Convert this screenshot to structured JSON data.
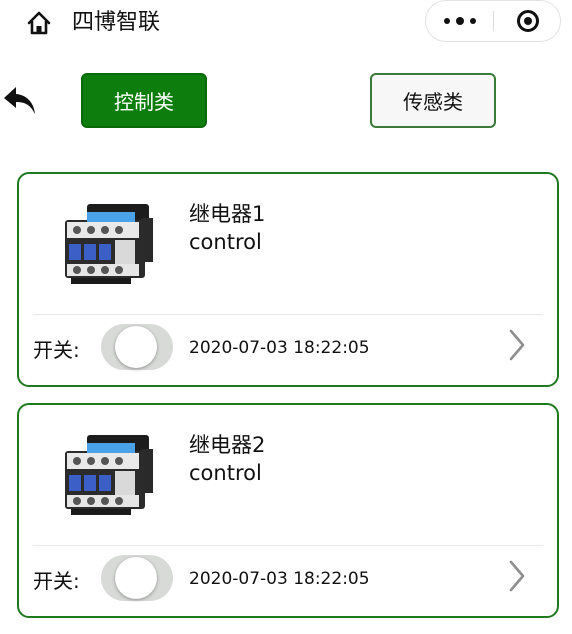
{
  "navbar": {
    "title": "四博智联",
    "home_icon": "home-icon",
    "more_icon": "more-dots-icon",
    "close_icon": "target-close-icon"
  },
  "back_icon": "back-arrow-icon",
  "categories": [
    {
      "label": "控制类",
      "active": true
    },
    {
      "label": "传感类",
      "active": false
    }
  ],
  "devices": [
    {
      "name": "继电器1",
      "type": "control",
      "switch_label": "开关:",
      "switch_on": false,
      "updated": "2020-07-03 18:22:05"
    },
    {
      "name": "继电器2",
      "type": "control",
      "switch_label": "开关:",
      "switch_on": false,
      "updated": "2020-07-03 18:22:05"
    }
  ],
  "colors": {
    "accent": "#0d7d0d",
    "card_border": "#1f7a1f",
    "toggle_off": "#d8dad8"
  }
}
